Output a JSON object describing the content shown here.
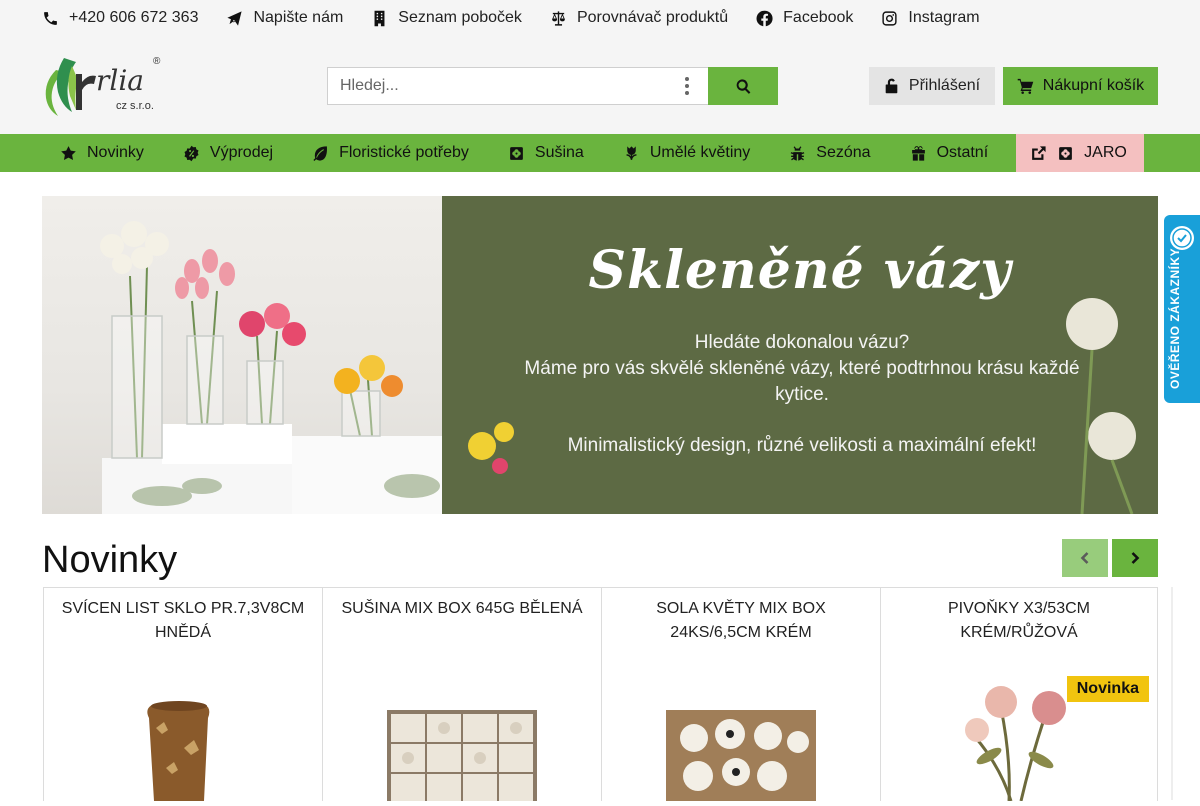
{
  "topbar": {
    "phone": "+420 606 672 363",
    "write": "Napište nám",
    "branches": "Seznam poboček",
    "compare": "Porovnávač produktů",
    "facebook": "Facebook",
    "instagram": "Instagram"
  },
  "logo": {
    "name": "rlia",
    "sub": "cz s.r.o.",
    "mark": "®"
  },
  "search": {
    "placeholder": "Hledej..."
  },
  "login": {
    "label": "Přihlášení"
  },
  "cart": {
    "label": "Nákupní košík"
  },
  "nav": {
    "items": [
      {
        "label": "Novinky",
        "icon": "star-icon"
      },
      {
        "label": "Výprodej",
        "icon": "badge-icon"
      },
      {
        "label": "Floristické potřeby",
        "icon": "leaf-icon"
      },
      {
        "label": "Sušina",
        "icon": "flower-icon"
      },
      {
        "label": "Umělé květiny",
        "icon": "tulip-icon"
      },
      {
        "label": "Sezóna",
        "icon": "bug-icon"
      },
      {
        "label": "Ostatní",
        "icon": "gift-icon"
      },
      {
        "label": "JARO",
        "icon": "flower-icon"
      }
    ]
  },
  "banner": {
    "title": "Skleněné vázy",
    "line1": "Hledáte dokonalou vázu?",
    "line2": "Máme pro vás skvělé skleněné vázy, které podtrhnou krásu každé",
    "line3": "kytice.",
    "line4": "Minimalistický design, různé velikosti a maximální efekt!"
  },
  "badge": {
    "text": "OVĚŘENO ZÁKAZNÍKY"
  },
  "section": {
    "title": "Novinky"
  },
  "products": [
    {
      "name": "SVÍCEN LIST SKLO PR.7,3V8CM HNĚDÁ"
    },
    {
      "name": "SUŠINA MIX BOX 645G BĚLENÁ"
    },
    {
      "name": "SOLA KVĚTY MIX BOX 24KS/6,5CM KRÉM"
    },
    {
      "name": "PIVOŇKY X3/53CM KRÉM/RŮŽOVÁ",
      "tag": "Novinka"
    }
  ],
  "colors": {
    "green": "#6ab43e",
    "jaro": "#f4c0c0",
    "badge": "#19a0d9",
    "banner_bg": "#5d6a44",
    "tag": "#f1c40f"
  }
}
